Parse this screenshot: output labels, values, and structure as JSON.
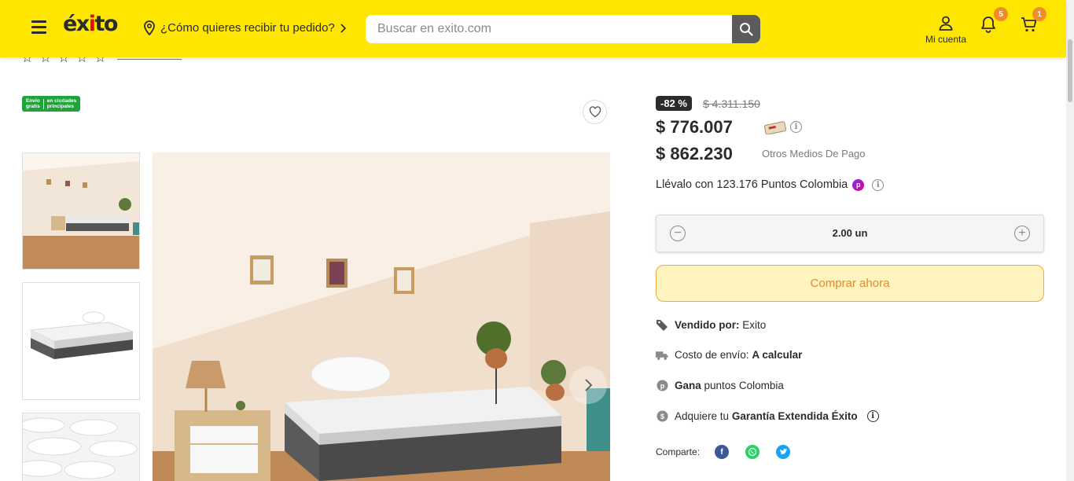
{
  "header": {
    "logo": "éxito",
    "location_prompt": "¿Cómo quieres recibir tu pedido?",
    "search_placeholder": "Buscar en exito.com",
    "account_label": "Mi cuenta",
    "notifications_count": "5",
    "cart_count": "1",
    "brand_color": "#ffe600",
    "badge_color": "#f28c28"
  },
  "product": {
    "free_shipping_line1": "Envío",
    "free_shipping_line2": "gratis",
    "free_shipping_line3": "en ciudades",
    "free_shipping_line4": "principales",
    "discount": "-82 %",
    "old_price": "$ 4.311.150",
    "price": "$ 776.007",
    "price_alt": "$ 862.230",
    "price_alt_label": "Otros Medios De Pago",
    "points_text": "Llévalo con 123.176 Puntos Colombia",
    "quantity": "2.00 un",
    "buy_label": "Comprar ahora"
  },
  "features": {
    "seller_label": "Vendido por:",
    "seller_value": "Exito",
    "shipping_label": "Costo de envío:",
    "shipping_value": "A calcular",
    "points_bold": "Gana",
    "points_rest": "puntos Colombia",
    "warranty_prefix": "Adquiere tu",
    "warranty_bold": "Garantía Extendida Éxito"
  },
  "share": {
    "label": "Comparte:",
    "icons": [
      "facebook-icon",
      "whatsapp-icon",
      "twitter-icon"
    ]
  }
}
